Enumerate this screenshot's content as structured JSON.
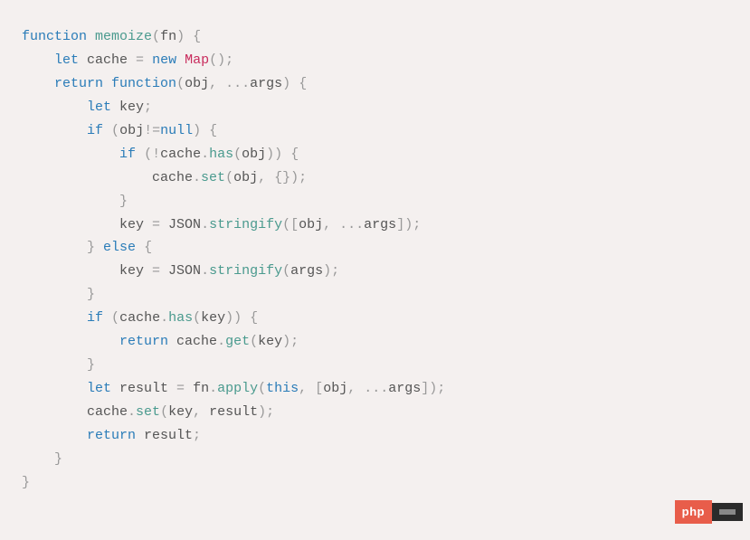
{
  "tokens": [
    [
      [
        "function",
        "kw-blue"
      ],
      [
        " ",
        "default"
      ],
      [
        "memoize",
        "fn-teal"
      ],
      [
        "(",
        "punct"
      ],
      [
        "fn",
        "default"
      ],
      [
        ")",
        "punct"
      ],
      [
        " ",
        "default"
      ],
      [
        "{",
        "punct"
      ]
    ],
    [
      [
        "    ",
        "default"
      ],
      [
        "let",
        "kw-blue"
      ],
      [
        " cache ",
        "default"
      ],
      [
        "=",
        "punct"
      ],
      [
        " ",
        "default"
      ],
      [
        "new",
        "kw-blue"
      ],
      [
        " ",
        "default"
      ],
      [
        "Map",
        "class-name"
      ],
      [
        "();",
        "punct"
      ]
    ],
    [
      [
        "    ",
        "default"
      ],
      [
        "return",
        "kw-blue"
      ],
      [
        " ",
        "default"
      ],
      [
        "function",
        "kw-blue"
      ],
      [
        "(",
        "punct"
      ],
      [
        "obj",
        "default"
      ],
      [
        ",",
        "punct"
      ],
      [
        " ",
        "default"
      ],
      [
        "...",
        "punct"
      ],
      [
        "args",
        "default"
      ],
      [
        ")",
        "punct"
      ],
      [
        " ",
        "default"
      ],
      [
        "{",
        "punct"
      ]
    ],
    [
      [
        "        ",
        "default"
      ],
      [
        "let",
        "kw-blue"
      ],
      [
        " key",
        "default"
      ],
      [
        ";",
        "punct"
      ]
    ],
    [
      [
        "        ",
        "default"
      ],
      [
        "if",
        "kw-blue"
      ],
      [
        " ",
        "default"
      ],
      [
        "(",
        "punct"
      ],
      [
        "obj",
        "default"
      ],
      [
        "!=",
        "punct"
      ],
      [
        "null",
        "kw-blue"
      ],
      [
        ")",
        "punct"
      ],
      [
        " ",
        "default"
      ],
      [
        "{",
        "punct"
      ]
    ],
    [
      [
        "            ",
        "default"
      ],
      [
        "if",
        "kw-blue"
      ],
      [
        " ",
        "default"
      ],
      [
        "(!",
        "punct"
      ],
      [
        "cache",
        "default"
      ],
      [
        ".",
        "punct"
      ],
      [
        "has",
        "fn-teal"
      ],
      [
        "(",
        "punct"
      ],
      [
        "obj",
        "default"
      ],
      [
        "))",
        "punct"
      ],
      [
        " ",
        "default"
      ],
      [
        "{",
        "punct"
      ]
    ],
    [
      [
        "                cache",
        "default"
      ],
      [
        ".",
        "punct"
      ],
      [
        "set",
        "fn-teal"
      ],
      [
        "(",
        "punct"
      ],
      [
        "obj",
        "default"
      ],
      [
        ",",
        "punct"
      ],
      [
        " ",
        "default"
      ],
      [
        "{});",
        "punct"
      ]
    ],
    [
      [
        "            ",
        "default"
      ],
      [
        "}",
        "punct"
      ]
    ],
    [
      [
        "            key ",
        "default"
      ],
      [
        "=",
        "punct"
      ],
      [
        " JSON",
        "default"
      ],
      [
        ".",
        "punct"
      ],
      [
        "stringify",
        "fn-teal"
      ],
      [
        "([",
        "punct"
      ],
      [
        "obj",
        "default"
      ],
      [
        ",",
        "punct"
      ],
      [
        " ",
        "default"
      ],
      [
        "...",
        "punct"
      ],
      [
        "args",
        "default"
      ],
      [
        "]);",
        "punct"
      ]
    ],
    [
      [
        "        ",
        "default"
      ],
      [
        "}",
        "punct"
      ],
      [
        " ",
        "default"
      ],
      [
        "else",
        "kw-blue"
      ],
      [
        " ",
        "default"
      ],
      [
        "{",
        "punct"
      ]
    ],
    [
      [
        "            key ",
        "default"
      ],
      [
        "=",
        "punct"
      ],
      [
        " JSON",
        "default"
      ],
      [
        ".",
        "punct"
      ],
      [
        "stringify",
        "fn-teal"
      ],
      [
        "(",
        "punct"
      ],
      [
        "args",
        "default"
      ],
      [
        ");",
        "punct"
      ]
    ],
    [
      [
        "        ",
        "default"
      ],
      [
        "}",
        "punct"
      ]
    ],
    [
      [
        "        ",
        "default"
      ],
      [
        "if",
        "kw-blue"
      ],
      [
        " ",
        "default"
      ],
      [
        "(",
        "punct"
      ],
      [
        "cache",
        "default"
      ],
      [
        ".",
        "punct"
      ],
      [
        "has",
        "fn-teal"
      ],
      [
        "(",
        "punct"
      ],
      [
        "key",
        "default"
      ],
      [
        "))",
        "punct"
      ],
      [
        " ",
        "default"
      ],
      [
        "{",
        "punct"
      ]
    ],
    [
      [
        "            ",
        "default"
      ],
      [
        "return",
        "kw-blue"
      ],
      [
        " cache",
        "default"
      ],
      [
        ".",
        "punct"
      ],
      [
        "get",
        "fn-teal"
      ],
      [
        "(",
        "punct"
      ],
      [
        "key",
        "default"
      ],
      [
        ");",
        "punct"
      ]
    ],
    [
      [
        "        ",
        "default"
      ],
      [
        "}",
        "punct"
      ]
    ],
    [
      [
        "        ",
        "default"
      ],
      [
        "let",
        "kw-blue"
      ],
      [
        " result ",
        "default"
      ],
      [
        "=",
        "punct"
      ],
      [
        " fn",
        "default"
      ],
      [
        ".",
        "punct"
      ],
      [
        "apply",
        "fn-teal"
      ],
      [
        "(",
        "punct"
      ],
      [
        "this",
        "kw-blue"
      ],
      [
        ",",
        "punct"
      ],
      [
        " ",
        "default"
      ],
      [
        "[",
        "punct"
      ],
      [
        "obj",
        "default"
      ],
      [
        ",",
        "punct"
      ],
      [
        " ",
        "default"
      ],
      [
        "...",
        "punct"
      ],
      [
        "args",
        "default"
      ],
      [
        "]);",
        "punct"
      ]
    ],
    [
      [
        "        cache",
        "default"
      ],
      [
        ".",
        "punct"
      ],
      [
        "set",
        "fn-teal"
      ],
      [
        "(",
        "punct"
      ],
      [
        "key",
        "default"
      ],
      [
        ",",
        "punct"
      ],
      [
        " result",
        "default"
      ],
      [
        ");",
        "punct"
      ]
    ],
    [
      [
        "        ",
        "default"
      ],
      [
        "return",
        "kw-blue"
      ],
      [
        " result",
        "default"
      ],
      [
        ";",
        "punct"
      ]
    ],
    [
      [
        "    ",
        "default"
      ],
      [
        "}",
        "punct"
      ]
    ],
    [
      [
        "}",
        "punct"
      ]
    ]
  ],
  "watermark": {
    "label": "php"
  }
}
